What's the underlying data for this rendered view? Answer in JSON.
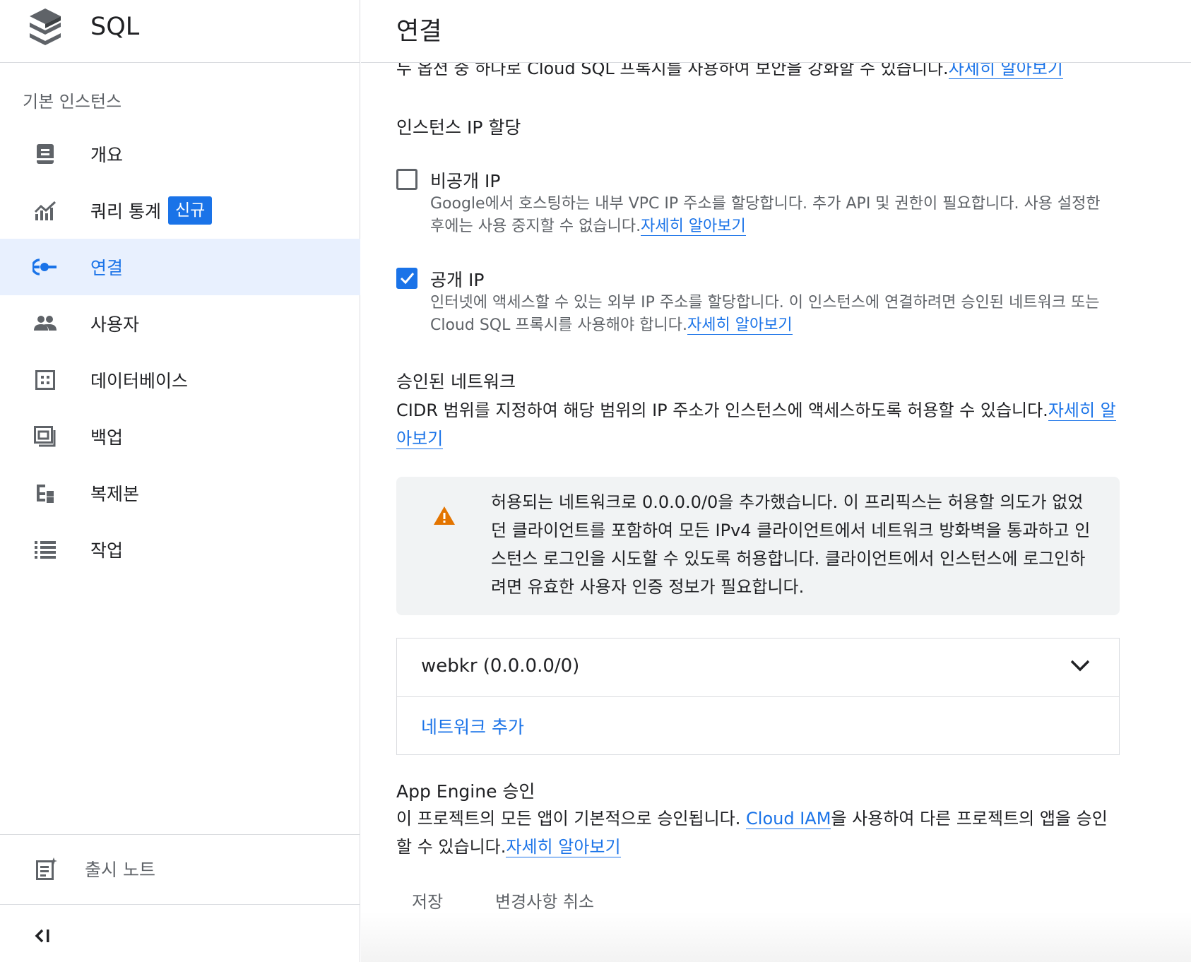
{
  "app": {
    "title": "SQL"
  },
  "sidebar": {
    "section": "기본 인스턴스",
    "items": [
      {
        "label": "개요",
        "icon": "overview-icon"
      },
      {
        "label": "쿼리 통계",
        "icon": "query-insights-icon",
        "badge": "신규"
      },
      {
        "label": "연결",
        "icon": "connections-icon",
        "active": true
      },
      {
        "label": "사용자",
        "icon": "users-icon"
      },
      {
        "label": "데이터베이스",
        "icon": "databases-icon"
      },
      {
        "label": "백업",
        "icon": "backups-icon"
      },
      {
        "label": "복제본",
        "icon": "replicas-icon"
      },
      {
        "label": "작업",
        "icon": "operations-icon"
      }
    ],
    "release_notes": "출시 노트",
    "collapse_icon": "collapse-sidebar-icon"
  },
  "main": {
    "title": "연결",
    "clipped_line": "두 옵션 중 하나로 Cloud SQL 프록시를 사용하여 보안을 강화할 수 있습니다.",
    "clipped_link": "자세히 알아보기",
    "ip_section": {
      "title": "인스턴스 IP 할당",
      "private": {
        "label": "비공개 IP",
        "checked": false,
        "desc": "Google에서 호스팅하는 내부 VPC IP 주소를 할당합니다. 추가 API 및 권한이 필요합니다. 사용 설정한 후에는 사용 중지할 수 없습니다.",
        "link": "자세히 알아보기"
      },
      "public": {
        "label": "공개 IP",
        "checked": true,
        "desc": "인터넷에 액세스할 수 있는 외부 IP 주소를 할당합니다. 이 인스턴스에 연결하려면 승인된 네트워크 또는 Cloud SQL 프록시를 사용해야 합니다.",
        "link": "자세히 알아보기"
      }
    },
    "authorized": {
      "title": "승인된 네트워크",
      "desc": "CIDR 범위를 지정하여 해당 범위의 IP 주소가 인스턴스에 액세스하도록 허용할 수 있습니다.",
      "link": "자세히 알아보기",
      "warning": "허용되는 네트워크로 0.0.0.0/0을 추가했습니다. 이 프리픽스는 허용할 의도가 없었던 클라이언트를 포함하여 모든 IPv4 클라이언트에서 네트워크 방화벽을 통과하고 인스턴스 로그인을 시도할 수 있도록 허용합니다. 클라이언트에서 인스턴스에 로그인하려면 유효한 사용자 인증 정보가 필요합니다.",
      "networks": [
        {
          "name": "webkr (0.0.0.0/0)"
        }
      ],
      "add_label": "네트워크 추가"
    },
    "app_engine": {
      "title": "App Engine 승인",
      "desc_before": "이 프로젝트의 모든 앱이 기본적으로 승인됩니다. ",
      "iam_link": "Cloud IAM",
      "desc_after": "을 사용하여 다른 프로젝트의 앱을 승인할 수 있습니다.",
      "link": "자세히 알아보기"
    },
    "buttons": {
      "save": "저장",
      "cancel": "변경사항 취소"
    }
  },
  "colors": {
    "accent": "#1a73e8",
    "active_bg": "#e8f0fe",
    "warning": "#e37400",
    "icon_gray": "#5f6368"
  }
}
